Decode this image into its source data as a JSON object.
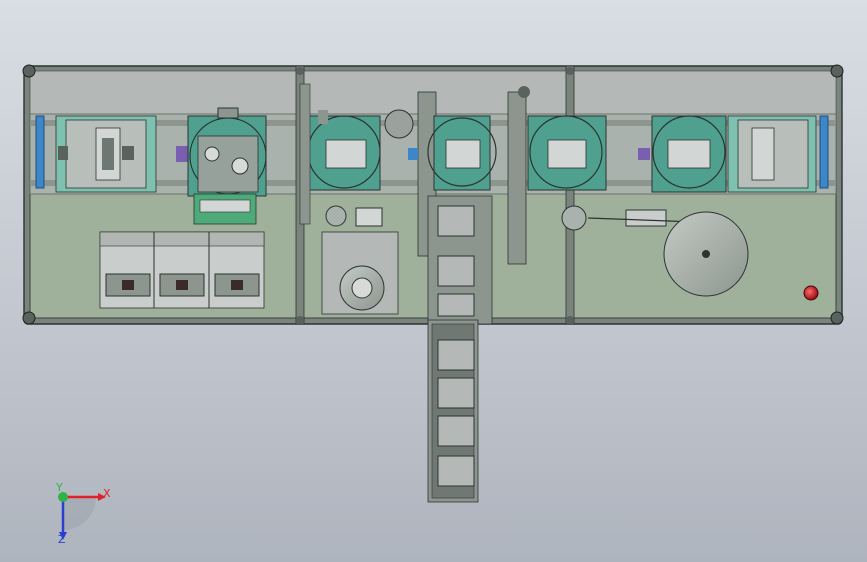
{
  "axes": {
    "x_label": "X",
    "y_label": "Y",
    "z_label": "Z",
    "x_color": "#e0202a",
    "y_color": "#2db34a",
    "z_color": "#2a3fd0"
  },
  "colors": {
    "background": "#c8cdd4",
    "frame": "#6f7a72",
    "top_strip": "#b4b9b7",
    "table_green": "#9fb09b",
    "machine_teal": "#4fa08f",
    "machine_grey": "#aab2ad",
    "rail_grey": "#8d958f",
    "accent_blue": "#3d86c8",
    "accent_purple": "#7a5fb0",
    "stop_red": "#c8141e",
    "dark_line": "#2c3330"
  },
  "icons": {
    "stop_button": "emergency-stop-icon",
    "triad": "coordinate-triad-icon"
  }
}
